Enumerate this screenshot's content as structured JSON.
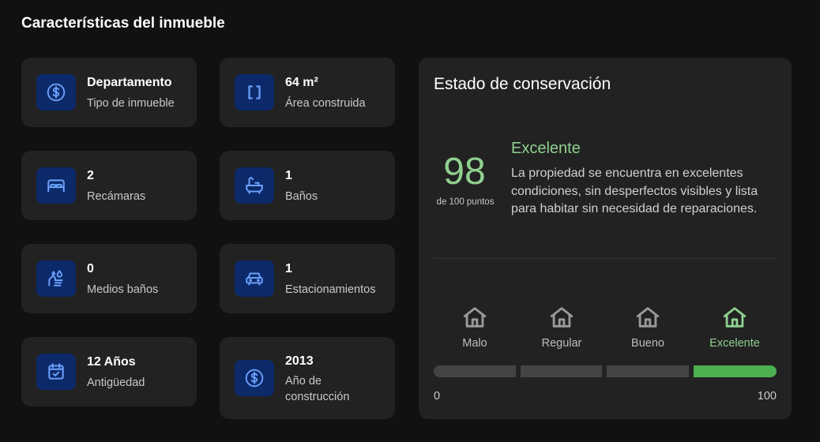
{
  "section_title": "Características del inmueble",
  "features": [
    {
      "icon": "dollar-icon",
      "value": "Departamento",
      "label": "Tipo de inmueble"
    },
    {
      "icon": "area-icon",
      "value": "64 m²",
      "label": "Área construida"
    },
    {
      "icon": "bed-icon",
      "value": "2",
      "label": "Recámaras"
    },
    {
      "icon": "bathtub-icon",
      "value": "1",
      "label": "Baños"
    },
    {
      "icon": "hand-wash-icon",
      "value": "0",
      "label": "Medios baños"
    },
    {
      "icon": "car-icon",
      "value": "1",
      "label": "Estacionamientos"
    },
    {
      "icon": "calendar-check-icon",
      "value": "12 Años",
      "label": "Antigüedad"
    },
    {
      "icon": "dollar-icon",
      "value": "2013",
      "label": "Año de construcción"
    }
  ],
  "conservation": {
    "title": "Estado de conservación",
    "score": "98",
    "score_sub": "de 100 puntos",
    "rating": "Excelente",
    "description": "La propiedad se encuentra en excelentes condiciones, sin desperfectos visibles y lista para habitar sin necesidad de reparaciones.",
    "levels": [
      {
        "label": "Malo",
        "icon": "house-icon"
      },
      {
        "label": "Regular",
        "icon": "house-icon"
      },
      {
        "label": "Bueno",
        "icon": "house-icon"
      },
      {
        "label": "Excelente",
        "icon": "house-icon",
        "active": true
      }
    ],
    "scale_min": "0",
    "scale_max": "100",
    "score_value": 98
  },
  "colors": {
    "background": "#111111",
    "card": "#222222",
    "icon_bg": "#0c2a6a",
    "icon_fg": "#6ea3ff",
    "accent_green": "#4caf50",
    "accent_green_text": "#8fd08f"
  }
}
